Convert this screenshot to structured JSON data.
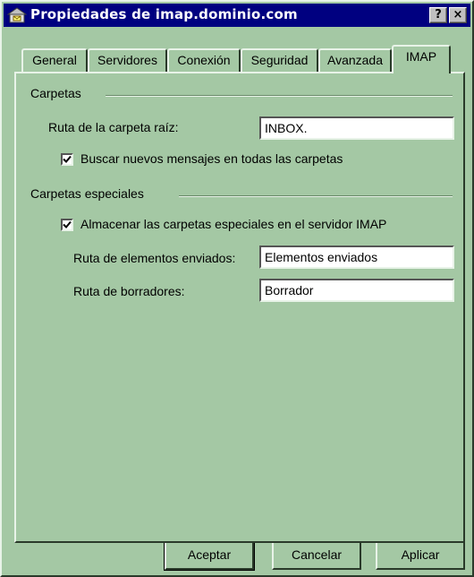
{
  "window": {
    "title": "Propiedades de imap.dominio.com",
    "help_button": "?",
    "close_button": "×"
  },
  "tabs": [
    "General",
    "Servidores",
    "Conexión",
    "Seguridad",
    "Avanzada",
    "IMAP"
  ],
  "active_tab": "IMAP",
  "carpetas": {
    "group_label": "Carpetas",
    "root_label": "Ruta de la carpeta raíz:",
    "root_value": "INBOX.",
    "check_new_label": "Buscar nuevos mensajes en todas las carpetas",
    "check_new_checked": true
  },
  "especiales": {
    "group_label": "Carpetas especiales",
    "store_label": "Almacenar las carpetas especiales en el servidor IMAP",
    "store_checked": true,
    "sent_label": "Ruta de elementos enviados:",
    "sent_value": "Elementos enviados",
    "drafts_label": "Ruta de borradores:",
    "drafts_value": "Borrador"
  },
  "buttons": {
    "ok": "Aceptar",
    "cancel": "Cancelar",
    "apply": "Aplicar"
  },
  "colors": {
    "face": "#a4c8a4",
    "titlebar": "#000080"
  }
}
